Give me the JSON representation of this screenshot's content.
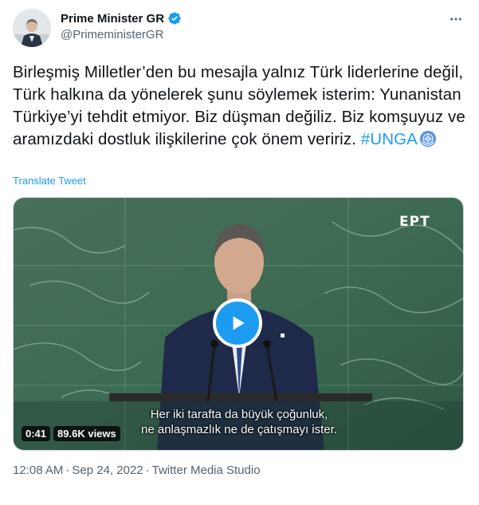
{
  "author": {
    "name": "Prime Minister GR",
    "handle": "@PrimeministerGR"
  },
  "tweet": {
    "text": "Birleşmiş Milletler’den bu mesajla yalnız Türk liderlerine değil, Türk halkına da yönelerek şunu söylemek isterim: Yunanistan Türkiye’yi tehdit etmiyor. Biz düşman değiliz. Biz komşuyuz ve aramızdaki dostluk ilişkilerine çok önem veririz.",
    "hashtag": "#UNGA",
    "translate_label": "Translate Tweet"
  },
  "video": {
    "channel_logo": "ΕΡΤ",
    "subtitle_line1": "Her iki tarafta da büyük çoğunluk,",
    "subtitle_line2": "ne anlaşmazlık ne de çatışmayı ister.",
    "duration": "0:41",
    "views": "89.6K views"
  },
  "meta": {
    "time": "12:08 AM",
    "separator": "·",
    "date": "Sep 24, 2022",
    "source": "Twitter Media Studio"
  },
  "colors": {
    "accent": "#1d9bf0",
    "secondary_text": "#536471"
  }
}
